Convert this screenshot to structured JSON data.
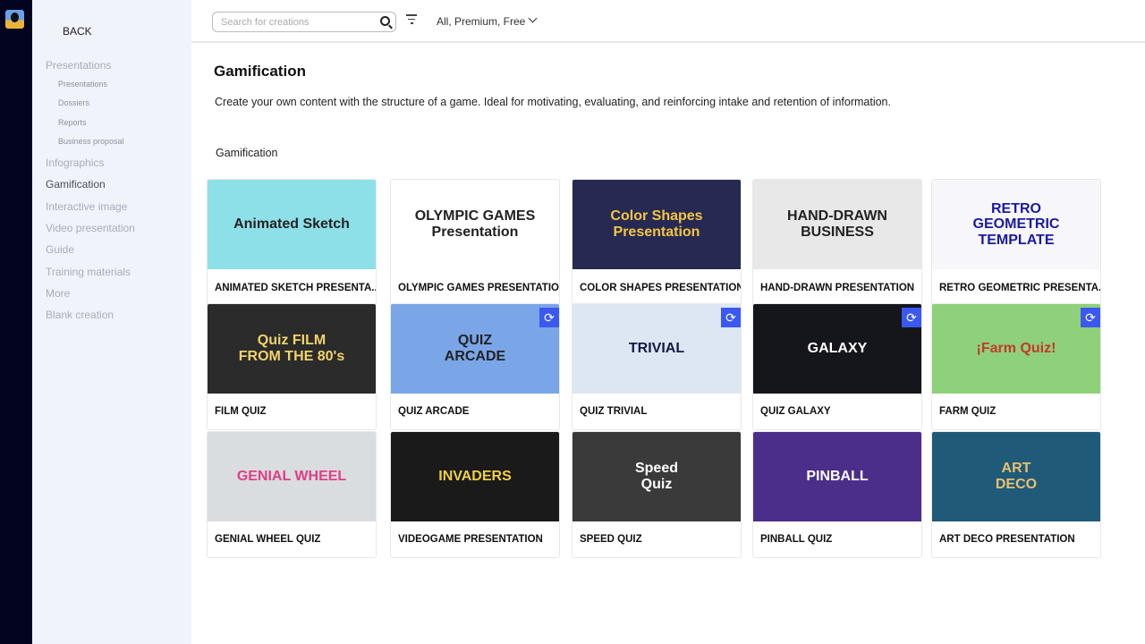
{
  "sidebar": {
    "back": "BACK",
    "items": [
      {
        "label": "Presentations",
        "level": 0
      },
      {
        "label": "Presentations",
        "level": 1
      },
      {
        "label": "Dossiers",
        "level": 1
      },
      {
        "label": "Reports",
        "level": 1
      },
      {
        "label": "Business proposal",
        "level": 1
      },
      {
        "label": "Infographics",
        "level": 0
      },
      {
        "label": "Gamification",
        "level": 0,
        "active": true
      },
      {
        "label": "Interactive image",
        "level": 0
      },
      {
        "label": "Video presentation",
        "level": 0
      },
      {
        "label": "Guide",
        "level": 0
      },
      {
        "label": "Training materials",
        "level": 0
      },
      {
        "label": "More",
        "level": 0
      },
      {
        "label": "Blank creation",
        "level": 0
      }
    ]
  },
  "toolbar": {
    "search_placeholder": "Search for creations",
    "plan_filter": "All, Premium, Free"
  },
  "main": {
    "title": "Gamification",
    "description": "Create your own content with the structure of a game. Ideal for motivating, evaluating, and reinforcing intake and retention of information.",
    "section": "Gamification",
    "cards": [
      {
        "label": "ANIMATED SKETCH PRESENTA...",
        "thumb": "Animated Sketch",
        "bg": "#8ee0e8",
        "fg": "#222",
        "sync": false
      },
      {
        "label": "OLYMPIC GAMES PRESENTATION",
        "thumb": "OLYMPIC GAMES\nPresentation",
        "bg": "#ffffff",
        "fg": "#222",
        "sync": false
      },
      {
        "label": "COLOR SHAPES PRESENTATION",
        "thumb": "Color Shapes\nPresentation",
        "bg": "#262a52",
        "fg": "#f5c542",
        "sync": false
      },
      {
        "label": "HAND-DRAWN PRESENTATION",
        "thumb": "HAND-DRAWN\nBUSINESS",
        "bg": "#e8e8e8",
        "fg": "#222",
        "sync": false
      },
      {
        "label": "RETRO GEOMETRIC PRESENTA...",
        "thumb": "RETRO\nGEOMETRIC\nTEMPLATE",
        "bg": "#f6f6fb",
        "fg": "#1a1aa0",
        "sync": false
      },
      {
        "label": "FILM QUIZ",
        "thumb": "Quiz FILM\nFROM THE 80's",
        "bg": "#2b2b2b",
        "fg": "#f2d36b",
        "sync": false
      },
      {
        "label": "QUIZ ARCADE",
        "thumb": "QUIZ\nARCADE",
        "bg": "#7aa6e8",
        "fg": "#222",
        "sync": true
      },
      {
        "label": "QUIZ TRIVIAL",
        "thumb": "TRIVIAL",
        "bg": "#dde6f3",
        "fg": "#141a44",
        "sync": true
      },
      {
        "label": "QUIZ GALAXY",
        "thumb": "GALAXY",
        "bg": "#15151c",
        "fg": "#fff",
        "sync": true
      },
      {
        "label": "FARM QUIZ",
        "thumb": "¡Farm Quiz!",
        "bg": "#8fd07a",
        "fg": "#c0392b",
        "sync": true
      },
      {
        "label": "GENIAL WHEEL QUIZ",
        "thumb": "GENIAL WHEEL",
        "bg": "#d9dde0",
        "fg": "#e23d84",
        "sync": false
      },
      {
        "label": "VIDEOGAME PRESENTATION",
        "thumb": "INVADERS",
        "bg": "#1a1a1a",
        "fg": "#f0d040",
        "sync": false
      },
      {
        "label": "SPEED QUIZ",
        "thumb": "Speed\nQuiz",
        "bg": "#3a3a3a",
        "fg": "#fff",
        "sync": false
      },
      {
        "label": "PINBALL QUIZ",
        "thumb": "PINBALL",
        "bg": "#4b2e8a",
        "fg": "#fff",
        "sync": false
      },
      {
        "label": "ART DECO PRESENTATION",
        "thumb": "ART\nDECO",
        "bg": "#1f5a78",
        "fg": "#e8c070",
        "sync": false
      }
    ]
  },
  "colors": {
    "rail": "#03041f",
    "sidebar": "#f1f3fb",
    "accent": "#3b59f2"
  },
  "icons": {
    "search": "search-icon",
    "filter": "filter-icon",
    "dropdown": "chevron-down-icon",
    "sync": "sync-icon"
  }
}
